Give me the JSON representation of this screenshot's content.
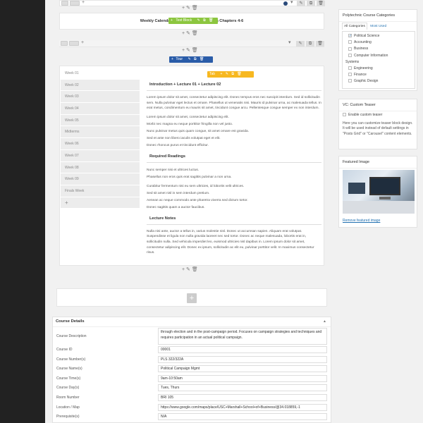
{
  "weekly_row": {
    "text_block": "Weekly Calendar: Don't forget... Friday on Chapters 4-6",
    "text_block_label": "Text Block"
  },
  "tabs_row": {
    "tour_label": "Tour",
    "tab_label": "Tab",
    "tabs": [
      "Week 01",
      "Week 02",
      "Week 03",
      "Week 04",
      "Week 05",
      "Midterms",
      "Week 06",
      "Week 07",
      "Week 08",
      "Week 09",
      "Finals Week"
    ],
    "add_tab": "+",
    "content": {
      "heading1": "Introduction + Lecture 01 + Lecture 02",
      "para1": "Lorem ipsum dolor sit amet, consectetur adipiscing elit. Donec tempus eros nec suscipit interdum. Sed id sollicitudin sem. Nulla pulvinar eget lectus et ornare. Phasellus ut venenatis nisi. Mauris id pulvinar urna, ac malesuada tellus. In erat metus, condimentum eu mauris sit amet, tincidunt congue arcu. Pellentesque congue semper ex non interdum.",
      "lines1": [
        "Lorem ipsum dolor sit amet, consectetur adipiscing elit.",
        "Morbi nec magna eu neque porttitor fringilla non vel justo.",
        "Nunc pulvinar metus quis quam congue, sit amet ornare est gravida.",
        "Sed et ante non libero iaculis volutpat eget et elit.",
        "Donec rhoncus purus et tincidunt efficitur."
      ],
      "heading2": "Required Readings",
      "lines2": [
        "Nunc semper nisi et ultrices luctus.",
        "Phasellus non eros quis erat sagittis pulvinar a non urna."
      ],
      "lines3": [
        "Curabitur fermentum nisi eu sem ultricies, id lobortis velit ultrices.",
        "Sed sit amet nisl in sem interdum pretium.",
        "Aenean ac neque commodo ante pharetra viverra sed dictum tortor.",
        "Donec sagittis quam a auctor faucibus."
      ],
      "heading3": "Lecture Notes",
      "para3": "Nulla nisi ante, auctor a tellus in, varius molestie nisl. Donec ut accumsan sapien. Aliquam erat volutpat. Suspendisse et ligula non nulla gravida laoreet nec sed tortor. Donec ac neque malesuada, lobortis erat in, sollicitudin nulla. Sed vehicula imperdiet leo, euismod ultricies nisl dapibus in. Lorem ipsum dolor sit amet, consectetur adipiscing elit. Donec ex ipsum, sollicitudin ac elit eu, pulvinar porttitor velit. In maximus consectetur risus."
    }
  },
  "course_details": {
    "title": "Course Details",
    "toggle": "▲",
    "fields": [
      {
        "label": "Course Description",
        "value": "through election and in the post-campaign period. Focuses on campaign strategies and techniques and requires participation in an actual political campaign."
      },
      {
        "label": "Course ID",
        "value": "00001"
      },
      {
        "label": "Course Number(s)",
        "value": "PLS 322/322A"
      },
      {
        "label": "Course Name(s)",
        "value": "Political  Campaign  Mgmt"
      },
      {
        "label": "Course Time(s)",
        "value": "9am-10:50am"
      },
      {
        "label": "Course Day(s)",
        "value": "Tues, Thurs"
      },
      {
        "label": "Room Number",
        "value": "BRI 105"
      },
      {
        "label": "Location / Map",
        "value": "https://www.google.com/maps/place/USC+Marshall+School+of+Business/@34.018859,-1"
      },
      {
        "label": "Prerequisite(s)",
        "value": "N/A"
      }
    ]
  },
  "categories_box": {
    "title": "Polytechnic Course Categories",
    "tab_all": "All Categories",
    "tab_most_used": "Most Used",
    "items": [
      {
        "label": "Political Science",
        "checked": true,
        "indent": true
      },
      {
        "label": "Accounting",
        "checked": false,
        "indent": true
      },
      {
        "label": "Business",
        "checked": false,
        "indent": true
      },
      {
        "label": "Computer Information",
        "checked": false,
        "indent": true
      },
      {
        "label": "Systems",
        "checked": false,
        "indent": false,
        "nobox": true
      },
      {
        "label": "Engineering",
        "checked": false,
        "indent": true
      },
      {
        "label": "Finance",
        "checked": false,
        "indent": true
      },
      {
        "label": "Graphic Design",
        "checked": false,
        "indent": true
      }
    ]
  },
  "custom_teaser_box": {
    "title": "VC: Custom Teaser",
    "checkbox_label": "Enable custom teaser",
    "description": "Here you can customize teaser block design. It will be used instead of default settings in \"Posts Grid\" or \"Carousel\" content elements."
  },
  "featured_image_box": {
    "title": "Featured Image",
    "remove_link": "Remove featured image"
  },
  "colors": {
    "accent_green": "#8cc63f",
    "accent_orange": "#f7b820",
    "accent_blue": "#2a5ca8",
    "link": "#2271b1"
  }
}
